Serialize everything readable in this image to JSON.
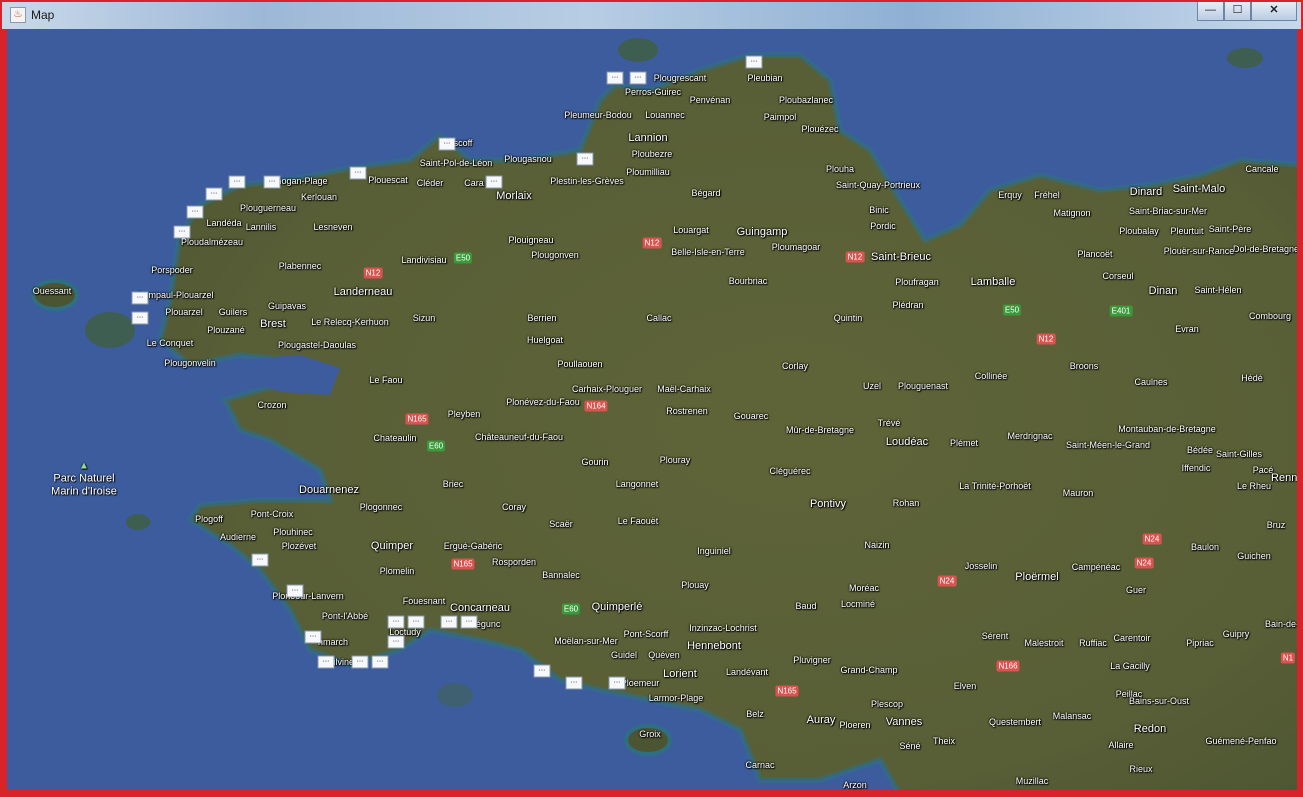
{
  "window": {
    "title": "Map",
    "app_icon": "java-cup-icon",
    "minimize": "—",
    "maximize": "☐",
    "close": "✕"
  },
  "colors": {
    "sea": "#3c5c9d",
    "land": "#5d6239",
    "border": "#d8232a"
  },
  "park": {
    "line1": "Parc Naturel",
    "line2": "Marin d'Iroise"
  },
  "marker_label": "...",
  "marker_count": 28,
  "places": [
    "Plougrescant",
    "Pleubian",
    "Perros-Guirec",
    "Penvénan",
    "Ploubazlanec",
    "Pleumeur-Bodou",
    "Louannec",
    "Paimpol",
    "Plouézec",
    "Lannion",
    "Ploubezre",
    "Plougasnou",
    "Ploumilliau",
    "scoff",
    "Saint-Pol-de-Léon",
    "Plouescat",
    "Cléder",
    "Cara",
    "Plestin-les-Grèves",
    "Plouha",
    "Saint-Quay-Portrieux",
    "Bégard",
    "Binic",
    "Pordic",
    "nogan-Plage",
    "Kerlouan",
    "Plouguerneau",
    "Landéda",
    "Lannilis",
    "Lesneven",
    "Morlaix",
    "Plouigneau",
    "Plougonven",
    "Louargat",
    "Guingamp",
    "Ploudalmézeau",
    "Belle-Isle-en-Terre",
    "Ploumagoar",
    "Saint-Brieuc",
    "Erquy",
    "Fréhel",
    "Dinard",
    "Saint-Malo",
    "Cancale",
    "Matignon",
    "Saint-Briac-sur-Mer",
    "Ploubalay",
    "Pleurtuit",
    "Saint-Père",
    "Plancoët",
    "Dol-de-Bretagne",
    "Corseul",
    "Plouër-sur-Rance",
    "Porspoder",
    "Plabennec",
    "Landivisiau",
    "Bourbriac",
    "Ploufragan",
    "Lamballe",
    "Dinan",
    "Saint-Hélen",
    "Lampaul-Plouarzel",
    "Landerneau",
    "Guipavas",
    "Plouarzel",
    "Guilers",
    "Brest",
    "Le Relecq-Kerhuon",
    "Sizun",
    "Berrien",
    "Callac",
    "Quintin",
    "Plédran",
    "Evran",
    "Combourg",
    "Plouzané",
    "Le Conquet",
    "Plougastel-Daoulas",
    "Huelgoat",
    "Plougonvelin",
    "Poullaouen",
    "Corlay",
    "Collinée",
    "Broons",
    "Caulnes",
    "Hédé",
    "Le Faou",
    "Carhaix-Plouguer",
    "Maël-Carhaix",
    "Uzel",
    "Plouguenast",
    "Crozon",
    "Pleyben",
    "Plonévez-du-Faou",
    "Rostrenen",
    "Gouarec",
    "Trévé",
    "Montauban-de-Bretagne",
    "Mûr-de-Bretagne",
    "Loudéac",
    "Plémet",
    "Merdrignac",
    "Saint-Méen-le-Grand",
    "Bédée",
    "Saint-Gilles",
    "Chateaulin",
    "Châteauneuf-du-Faou",
    "Gourin",
    "Plouray",
    "Cléguérec",
    "Iffendic",
    "Pacé",
    "Le Rheu",
    "Langonnet",
    "La Trinité-Porhoët",
    "Mauron",
    "Douarnenez",
    "Briec",
    "Rohan",
    "Pontivy",
    "Coray",
    "Plogonnec",
    "Pont-Croix",
    "Plogoff",
    "Scaër",
    "Le Faouët",
    "Plouhinec",
    "Audierne",
    "Plozévet",
    "Quimper",
    "Ergué-Gabéric",
    "Naizin",
    "Inguiniel",
    "Baulon",
    "Guichen",
    "Rosporden",
    "Josselin",
    "Ploërmel",
    "Campénéac",
    "Plomelin",
    "Bannalec",
    "Plouay",
    "Moréac",
    "Guer",
    "Plonéour-Lanvern",
    "Fouesnant",
    "Concarneau",
    "Quimperlé",
    "Baud",
    "Locminé",
    "Pont-l'Abbé",
    "Loctudy",
    "Inzinzac-Lochrist",
    "Pont-Scorff",
    "Sérent",
    "Malestroit",
    "Ruffiac",
    "Carentoir",
    "Pipriac",
    "Guipry",
    "nmarch",
    "Moëlan-sur-Mer",
    "Guidel",
    "Quéven",
    "Hennebont",
    "Landévant",
    "Pluvigner",
    "Grand-Champ",
    "Lorient",
    "Ploemeur",
    "Larmor-Plage",
    "Elven",
    "La Gacilly",
    "Plescop",
    "Peillac",
    "Bains-sur-Oust",
    "Belz",
    "Auray",
    "Ploeren",
    "Vannes",
    "Questembert",
    "Malansac",
    "Redon",
    "Allaire",
    "Guémené-Penfao",
    "Theix",
    "Séné",
    "Carnac",
    "Rieux",
    "Arzon",
    "Muzillac",
    "Groix",
    "Ouessant",
    "Rennes",
    "Bruz",
    "Bain-de-B",
    "Guilvinec",
    "Trégunc"
  ],
  "roads": [
    {
      "label": "N12",
      "type": "national"
    },
    {
      "label": "N12",
      "type": "national"
    },
    {
      "label": "N12",
      "type": "national"
    },
    {
      "label": "N12",
      "type": "national"
    },
    {
      "label": "N165",
      "type": "national"
    },
    {
      "label": "N164",
      "type": "national"
    },
    {
      "label": "N165",
      "type": "national"
    },
    {
      "label": "N165",
      "type": "national"
    },
    {
      "label": "N166",
      "type": "national"
    },
    {
      "label": "N24",
      "type": "national"
    },
    {
      "label": "N24",
      "type": "national"
    },
    {
      "label": "N24",
      "type": "national"
    },
    {
      "label": "N1",
      "type": "national"
    },
    {
      "label": "E50",
      "type": "european"
    },
    {
      "label": "E50",
      "type": "european"
    },
    {
      "label": "E401",
      "type": "european"
    },
    {
      "label": "E60",
      "type": "european"
    },
    {
      "label": "E60",
      "type": "european"
    }
  ]
}
